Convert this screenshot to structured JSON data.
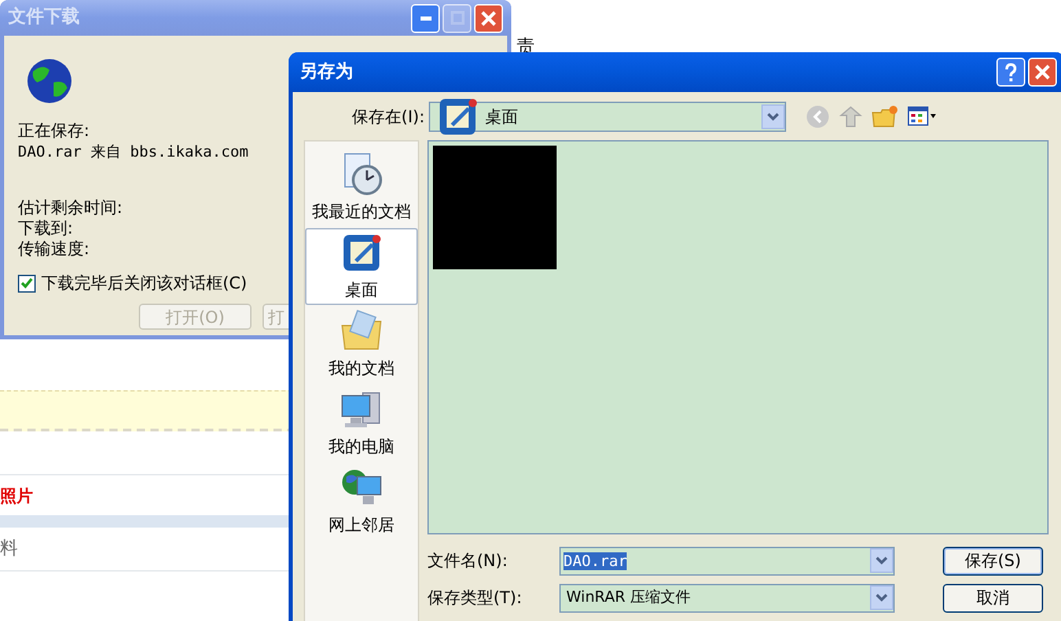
{
  "background_page": {
    "top_fragment": "责",
    "red_link": "照片",
    "gray_text": "料"
  },
  "download_dialog": {
    "title": "文件下载",
    "active": false,
    "window_buttons": [
      {
        "kind": "minimize",
        "disabled": false
      },
      {
        "kind": "maximize",
        "disabled": true
      },
      {
        "kind": "close",
        "disabled": false
      }
    ],
    "saving_label": "正在保存:",
    "source": "DAO.rar 来自 bbs.ikaka.com",
    "fields": [
      "估计剩余时间:",
      "下载到:",
      "传输速度:"
    ],
    "close_checkbox": {
      "label": "下载完毕后关闭该对话框(C)",
      "checked": true
    },
    "buttons": [
      {
        "label": "打开(O)",
        "disabled": true
      },
      {
        "label": "打",
        "disabled": true
      }
    ]
  },
  "save_as_dialog": {
    "title": "另存为",
    "active": true,
    "window_buttons": [
      {
        "kind": "help",
        "disabled": false
      },
      {
        "kind": "close",
        "disabled": false
      }
    ],
    "save_in": {
      "label": "保存在(I):",
      "value": "桌面"
    },
    "places": [
      {
        "kind": "recent",
        "label": "我最近的文档",
        "selected": false
      },
      {
        "kind": "desktop",
        "label": "桌面",
        "selected": true
      },
      {
        "kind": "documents",
        "label": "我的文档",
        "selected": false
      },
      {
        "kind": "computer",
        "label": "我的电脑",
        "selected": false
      },
      {
        "kind": "network",
        "label": "网上邻居",
        "selected": false
      }
    ],
    "file_name": {
      "label": "文件名(N):",
      "value": "DAO.rar"
    },
    "file_type": {
      "label": "保存类型(T):",
      "value": "WinRAR 压缩文件"
    },
    "buttons": [
      "保存(S)",
      "取消"
    ]
  }
}
